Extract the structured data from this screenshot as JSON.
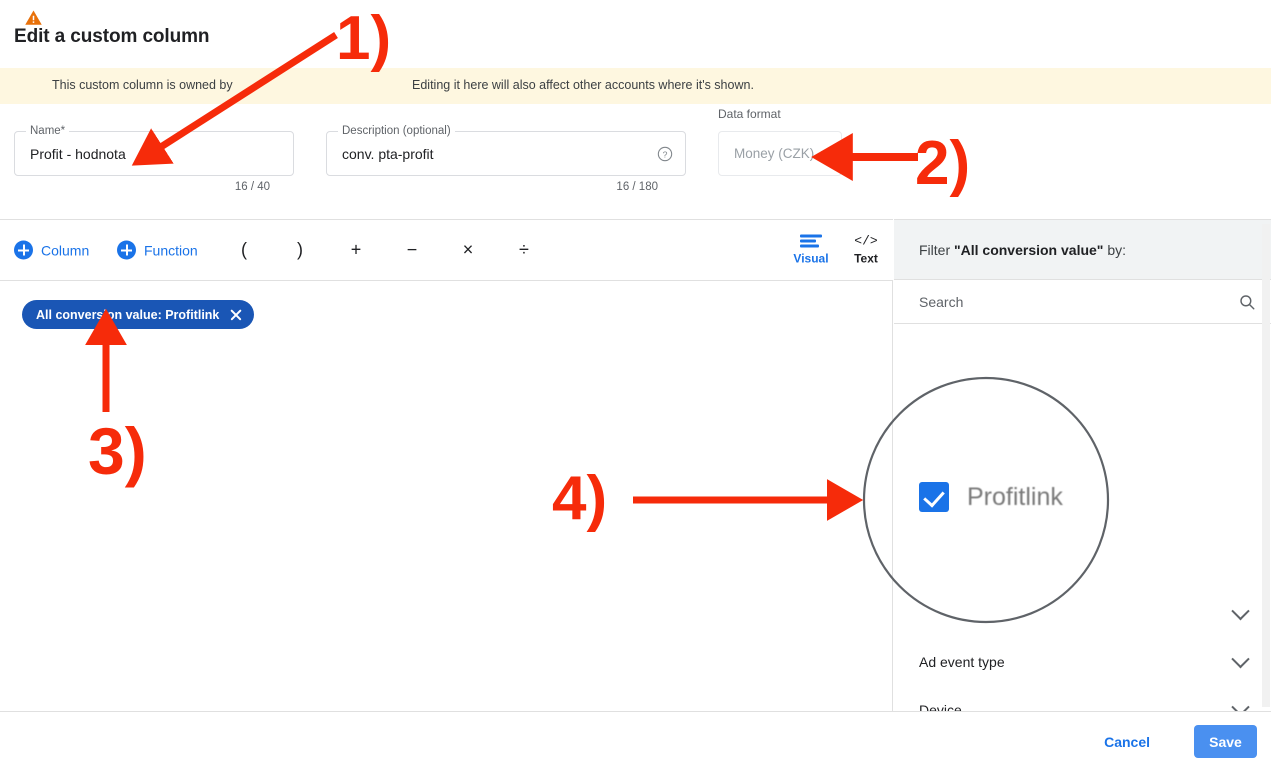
{
  "header": {
    "title": "Edit a custom column"
  },
  "warning": {
    "icon": "warning-triangle-icon",
    "text_part1": "This custom column is owned by",
    "text_part2": "Editing it here will also affect other accounts where it's shown.",
    "background_color": "#fef7e0",
    "icon_color": "#e8710a"
  },
  "name_field": {
    "label": "Name*",
    "value": "Profit - hodnota",
    "placeholder": "Name*",
    "counter": "16 / 40"
  },
  "description_field": {
    "label": "Description (optional)",
    "value": "conv. pta-profit",
    "placeholder": "Description (optional)",
    "counter": "16 / 180",
    "help_icon": "help-circle-icon"
  },
  "data_format": {
    "label": "Data format",
    "selected": "Money (CZK)",
    "options": [
      "Money (CZK)"
    ],
    "caret_icon": "chevron-down-icon",
    "disabled": true
  },
  "toolbar": {
    "column_label": "Column",
    "function_label": "Function",
    "operators": [
      "(",
      ")",
      "+",
      "−",
      "×",
      "÷"
    ],
    "operator_names": [
      "left-paren",
      "right-paren",
      "plus",
      "minus",
      "multiply",
      "divide"
    ],
    "visual_label": "Visual",
    "text_label": "Text",
    "visual_icon": "align-lines-icon",
    "text_icon": "code-brackets-icon",
    "active_mode": "Visual",
    "accent_color": "#1a73e8"
  },
  "formula": {
    "chip_label": "All conversion value: Profitlink",
    "chip_close_icon": "close-x-icon",
    "chip_color": "#1a56b5"
  },
  "filter_panel": {
    "header_prefix": "Filter ",
    "header_quoted": "\"All conversion value\"",
    "header_suffix": " by:",
    "search_placeholder": "Search",
    "search_value": "",
    "search_icon": "search-icon",
    "option": {
      "label": "Profitlink",
      "checked": true,
      "checkbox_color": "#1a73e8"
    },
    "rows": [
      {
        "label": "",
        "chevron": "chevron-down-icon"
      },
      {
        "label": "Ad event type",
        "chevron": "chevron-down-icon"
      },
      {
        "label": "Device",
        "chevron": "chevron-down-icon"
      }
    ]
  },
  "footer": {
    "cancel_label": "Cancel",
    "save_label": "Save",
    "save_color": "#4a90f0",
    "cancel_color": "#1a73e8"
  },
  "annotations": {
    "color": "#f62b0a",
    "items": [
      {
        "label": "1)",
        "target": "name-field"
      },
      {
        "label": "2)",
        "target": "data-format-select"
      },
      {
        "label": "3)",
        "target": "formula-chip"
      },
      {
        "label": "4)",
        "target": "profitlink-checkbox"
      }
    ]
  }
}
